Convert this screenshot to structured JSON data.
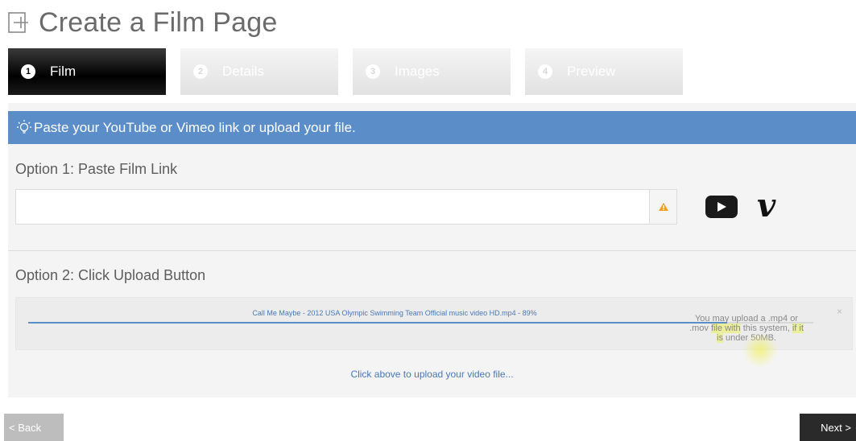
{
  "header": {
    "title": "Create a Film Page",
    "icon": "add-page-icon"
  },
  "tabs": [
    {
      "num": "1",
      "label": "Film",
      "active": true
    },
    {
      "num": "2",
      "label": "Details",
      "active": false
    },
    {
      "num": "3",
      "label": "Images",
      "active": false
    },
    {
      "num": "4",
      "label": "Preview",
      "active": false
    }
  ],
  "banner": {
    "icon": "lightbulb-icon",
    "text": "Paste your YouTube or Vimeo link or upload your file."
  },
  "option1": {
    "label": "Option 1: Paste Film Link",
    "input_value": "",
    "input_placeholder": "",
    "warning_icon": "warning-icon",
    "youtube_icon": "youtube-icon",
    "vimeo_icon": "vimeo-icon",
    "vimeo_glyph": "v"
  },
  "option2": {
    "label": "Option 2: Click Upload Button",
    "file_status": "Call Me Maybe - 2012 USA Olympic Swimming Team Official music video HD.mp4 - 89%",
    "progress": 0.89,
    "close_glyph": "×",
    "help_text_1": "You may upload a .mp4 or .mov ",
    "help_text_hl1": "file with",
    "help_text_2": " this system, ",
    "help_text_hl2": "if it is",
    "help_text_3": " under 50MB.",
    "click_hint": "Click above to upload your video file..."
  },
  "nav": {
    "back_label": "< Back",
    "next_label": "Next >"
  },
  "colors": {
    "accent": "#5b8ec8",
    "tab_active": "#000000",
    "tab_inactive": "#e6e6e6"
  }
}
